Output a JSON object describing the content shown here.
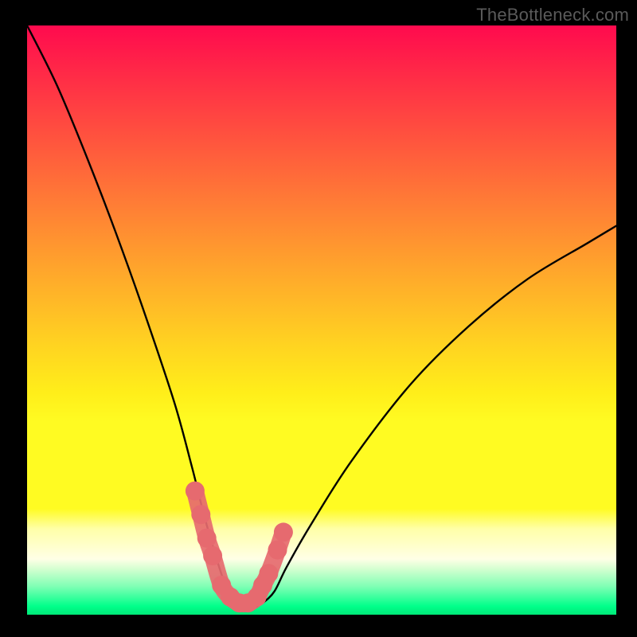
{
  "watermark": "TheBottleneck.com",
  "chart_data": {
    "type": "line",
    "title": "",
    "xlabel": "",
    "ylabel": "",
    "xlim": [
      0,
      100
    ],
    "ylim": [
      0,
      100
    ],
    "series": [
      {
        "name": "bottleneck-curve",
        "x": [
          0,
          5,
          10,
          15,
          20,
          25,
          28,
          30,
          32,
          34,
          35,
          36,
          37,
          38,
          40,
          42,
          44,
          48,
          55,
          65,
          75,
          85,
          95,
          100
        ],
        "values": [
          100,
          90,
          78,
          65,
          51,
          36,
          25,
          17,
          10,
          4,
          2,
          1,
          1,
          1,
          2,
          4,
          8,
          15,
          26,
          39,
          49,
          57,
          63,
          66
        ]
      }
    ],
    "markers": {
      "name": "highlight-points",
      "x": [
        28.5,
        29.5,
        30.5,
        31.5,
        33.0,
        34.5,
        36.0,
        37.5,
        39.0,
        40.0,
        41.0,
        42.5,
        43.5
      ],
      "values": [
        21,
        17,
        13,
        10,
        5,
        3,
        2,
        2,
        3,
        5,
        7,
        11,
        14
      ],
      "color": "#e66a6f"
    },
    "gradient_stops": [
      {
        "pos": 0.0,
        "color": "#ff0a4e"
      },
      {
        "pos": 0.5,
        "color": "#ffa42c"
      },
      {
        "pos": 0.82,
        "color": "#fffb22"
      },
      {
        "pos": 0.9,
        "color": "#ffffe0"
      },
      {
        "pos": 1.0,
        "color": "#00ff8a"
      }
    ]
  }
}
